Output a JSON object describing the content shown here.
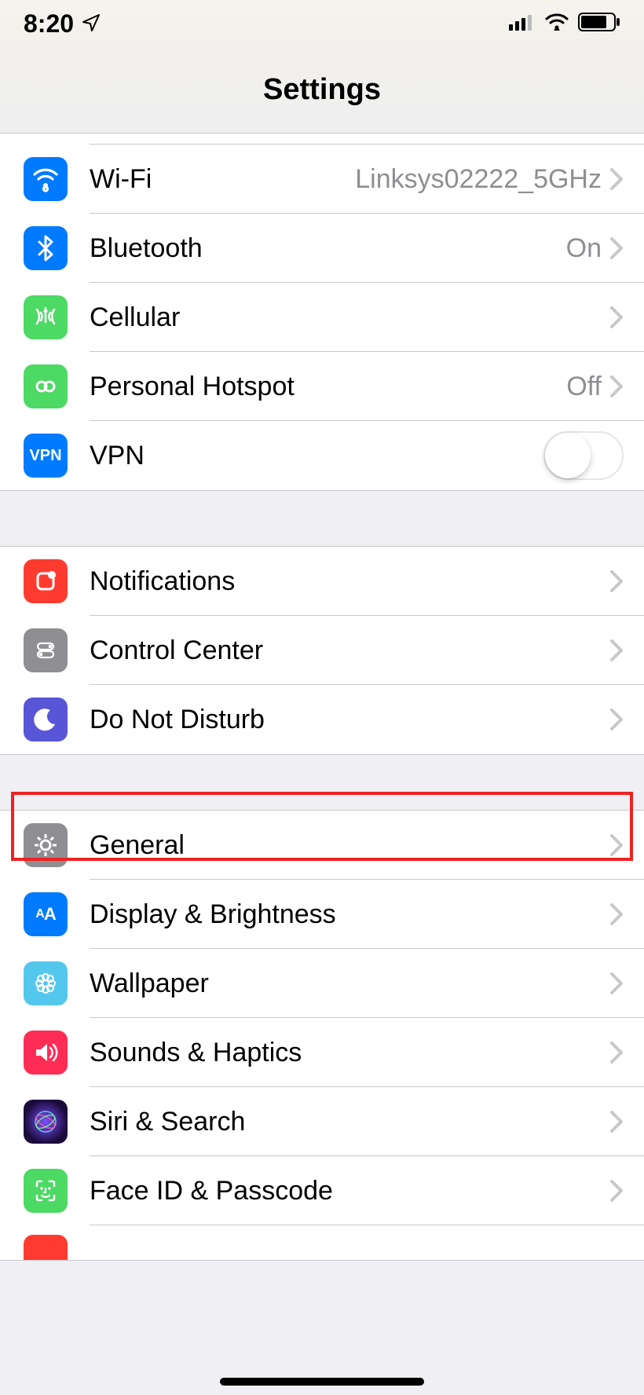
{
  "status": {
    "time": "8:20"
  },
  "header": {
    "title": "Settings"
  },
  "rows": {
    "wifi": {
      "label": "Wi-Fi",
      "detail": "Linksys02222_5GHz"
    },
    "bluetooth": {
      "label": "Bluetooth",
      "detail": "On"
    },
    "cellular": {
      "label": "Cellular"
    },
    "hotspot": {
      "label": "Personal Hotspot",
      "detail": "Off"
    },
    "vpn": {
      "label": "VPN",
      "icon_text": "VPN"
    },
    "notifications": {
      "label": "Notifications"
    },
    "controlcenter": {
      "label": "Control Center"
    },
    "dnd": {
      "label": "Do Not Disturb"
    },
    "general": {
      "label": "General"
    },
    "display": {
      "label": "Display & Brightness",
      "icon_text": "AA"
    },
    "wallpaper": {
      "label": "Wallpaper"
    },
    "sounds": {
      "label": "Sounds & Haptics"
    },
    "siri": {
      "label": "Siri & Search"
    },
    "faceid": {
      "label": "Face ID & Passcode"
    }
  }
}
